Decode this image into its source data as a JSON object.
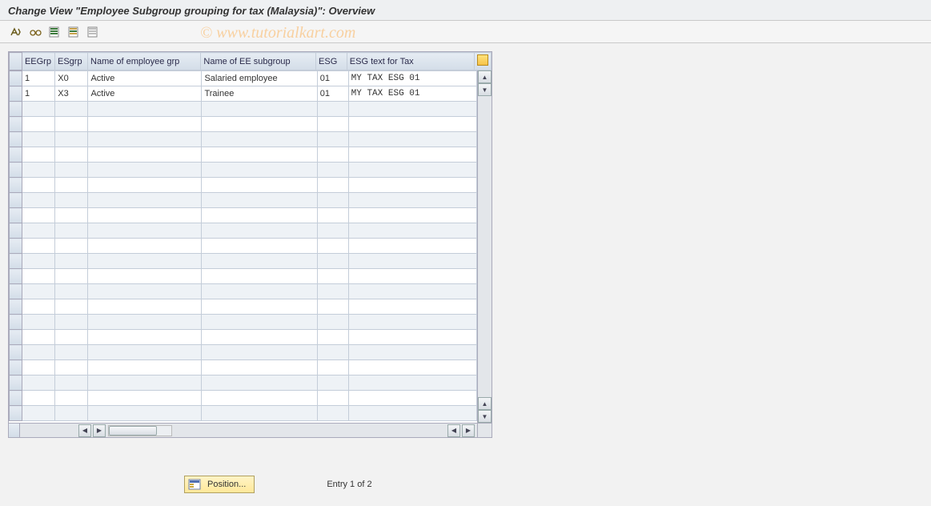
{
  "title": "Change View \"Employee Subgroup grouping for tax (Malaysia)\": Overview",
  "watermark": "© www.tutorialkart.com",
  "toolbar": {
    "icons": [
      "other-view",
      "glasses",
      "select-all",
      "select-block",
      "deselect-all"
    ]
  },
  "columns": {
    "rowsel": "",
    "eegrp": "EEGrp",
    "esgrp": "ESgrp",
    "name1": "Name of employee grp",
    "name2": "Name of EE subgroup",
    "esg": "ESG",
    "esgtext": "ESG text for Tax"
  },
  "rows": [
    {
      "eegrp": "1",
      "esgrp": "X0",
      "name1": "Active",
      "name2": "Salaried employee",
      "esg": "01",
      "esgtext": "MY TAX ESG 01"
    },
    {
      "eegrp": "1",
      "esgrp": "X3",
      "name1": "Active",
      "name2": "Trainee",
      "esg": "01",
      "esgtext": "MY TAX ESG 01"
    }
  ],
  "empty_row_count": 21,
  "footer": {
    "position_label": "Position...",
    "entry_text": "Entry 1 of 2"
  }
}
